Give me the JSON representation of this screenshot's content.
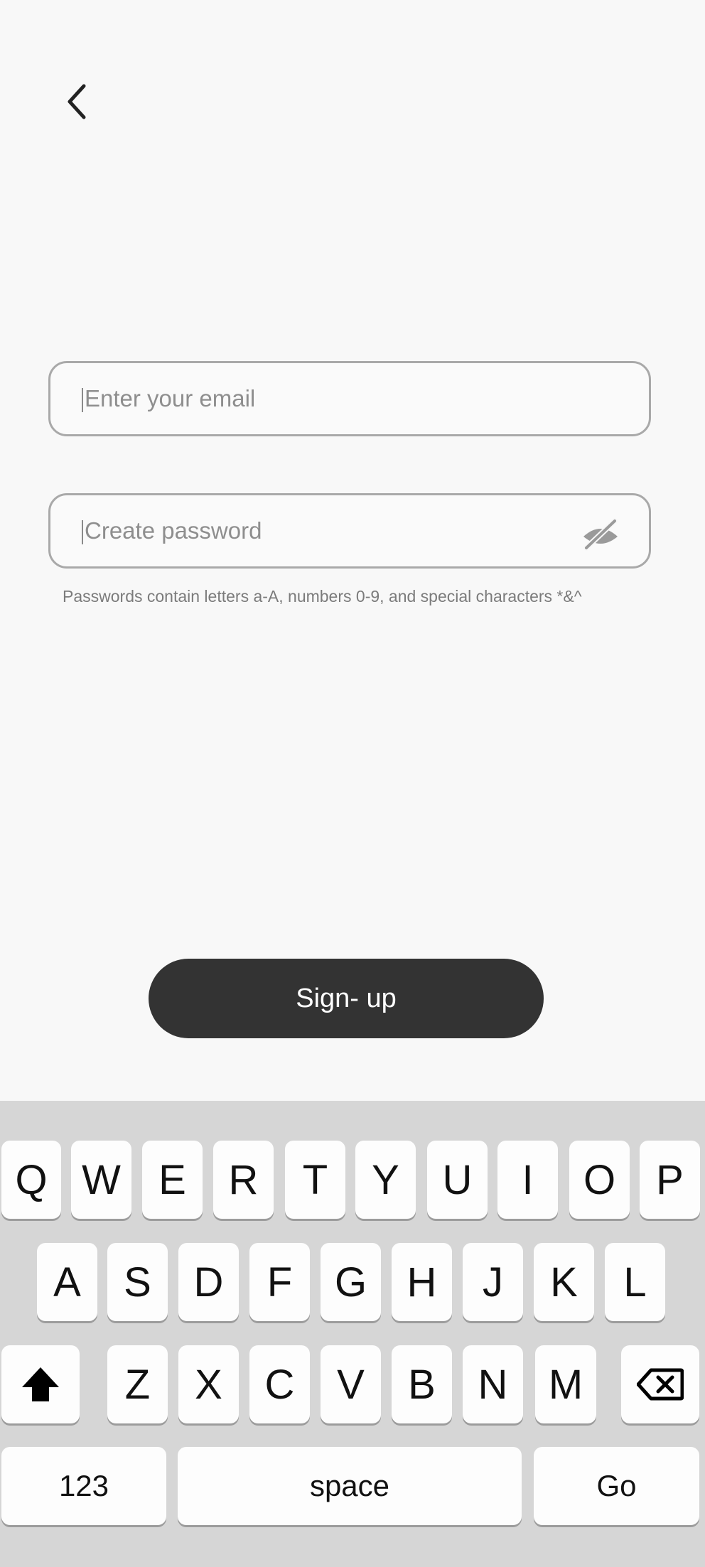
{
  "form": {
    "email_placeholder": "Enter your email",
    "password_placeholder": "Create password",
    "password_hint": "Passwords contain letters a-A, numbers 0-9, and special characters *&^",
    "signup_label": "Sign- up"
  },
  "keyboard": {
    "row1": [
      "Q",
      "W",
      "E",
      "R",
      "T",
      "Y",
      "U",
      "I",
      "O",
      "P"
    ],
    "row2": [
      "A",
      "S",
      "D",
      "F",
      "G",
      "H",
      "J",
      "K",
      "L"
    ],
    "row3": [
      "Z",
      "X",
      "C",
      "V",
      "B",
      "N",
      "M"
    ],
    "numbers_label": "123",
    "space_label": "space",
    "go_label": "Go"
  },
  "icons": {
    "back": "chevron-left-icon",
    "password_visibility": "eye-off-icon",
    "shift": "shift-arrow-icon",
    "backspace": "backspace-icon"
  },
  "colors": {
    "background": "#f8f8f8",
    "button": "#333333",
    "keyboard": "#d6d6d6",
    "field_border": "#a9a9a9"
  }
}
